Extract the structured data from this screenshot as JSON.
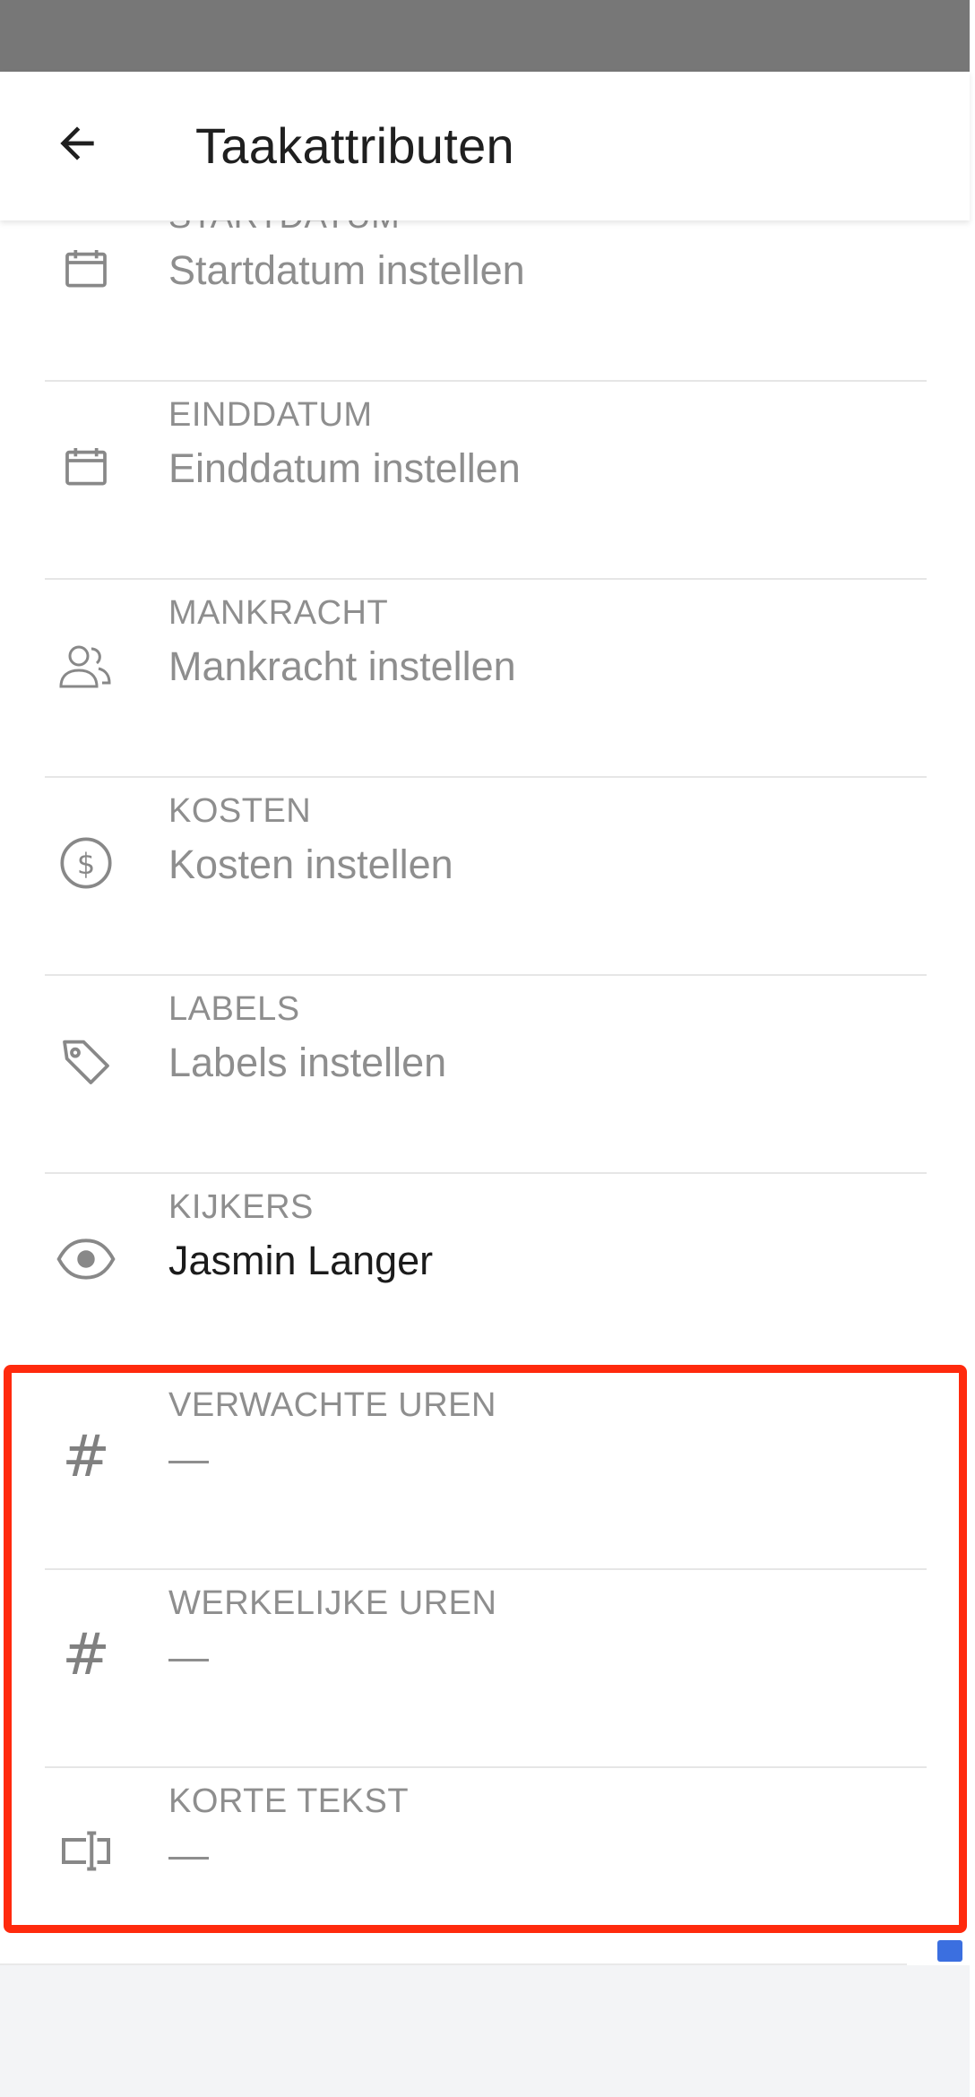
{
  "header": {
    "title": "Taakattributen"
  },
  "attributes": [
    {
      "label": "STARTDATUM",
      "value": "Startdatum instellen",
      "icon": "calendar-icon"
    },
    {
      "label": "EINDDATUM",
      "value": "Einddatum instellen",
      "icon": "calendar-icon"
    },
    {
      "label": "MANKRACHT",
      "value": "Mankracht instellen",
      "icon": "people-icon"
    },
    {
      "label": "KOSTEN",
      "value": "Kosten instellen",
      "icon": "dollar-circle-icon"
    },
    {
      "label": "LABELS",
      "value": "Labels instellen",
      "icon": "tag-icon"
    },
    {
      "label": "KIJKERS",
      "value": "Jasmin Langer",
      "icon": "eye-icon"
    },
    {
      "label": "VERWACHTE UREN",
      "value": "—",
      "icon": "hash-icon"
    },
    {
      "label": "WERKELIJKE UREN",
      "value": "—",
      "icon": "hash-icon"
    },
    {
      "label": "KORTE TEKST",
      "value": "—",
      "icon": "text-field-icon"
    }
  ],
  "colors": {
    "highlight": "#ff2a0d",
    "status_bar": "#777777",
    "muted_text": "#8e8e8e",
    "primary_text": "#1b1b1b"
  }
}
